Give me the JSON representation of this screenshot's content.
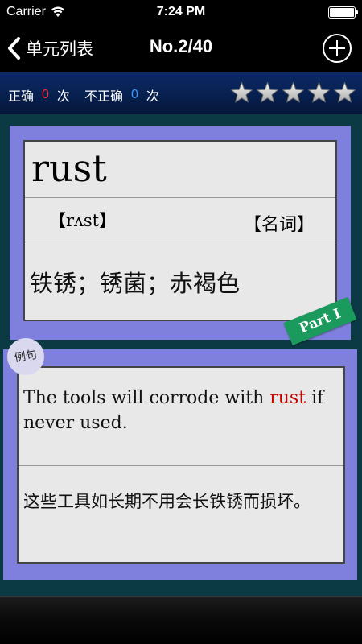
{
  "status_bar": {
    "carrier": "Carrier",
    "time": "7:24 PM",
    "battery_level": 1.0
  },
  "nav": {
    "back_label": "单元列表",
    "title": "No.2/40",
    "back_icon": "chevron-left-icon",
    "add_icon": "plus-circle-icon"
  },
  "score": {
    "correct_label": "正确",
    "correct_count": "0",
    "times_unit_1": "次",
    "incorrect_label": "不正确",
    "incorrect_count": "0",
    "times_unit_2": "次",
    "rating": 0,
    "max_rating": 5
  },
  "word": {
    "text": "rust",
    "phonetic": "【rʌst】",
    "part_of_speech": "【名词】",
    "meaning": "铁锈；锈菌；赤褐色"
  },
  "part_badge": "Part I",
  "example": {
    "tag": "例句",
    "sentence_before": "The tools will corrode with ",
    "sentence_highlight": "rust",
    "sentence_after": " if never used.",
    "translation": "这些工具如长期不用会长铁锈而损坏。"
  },
  "colors": {
    "card_border": "#7f80dd",
    "card_face": "#e8e8e8",
    "highlight": "#cc0000",
    "badge": "#1a9a5c",
    "wrong_count": "#ff2a2a",
    "right_count": "#3399ff"
  }
}
